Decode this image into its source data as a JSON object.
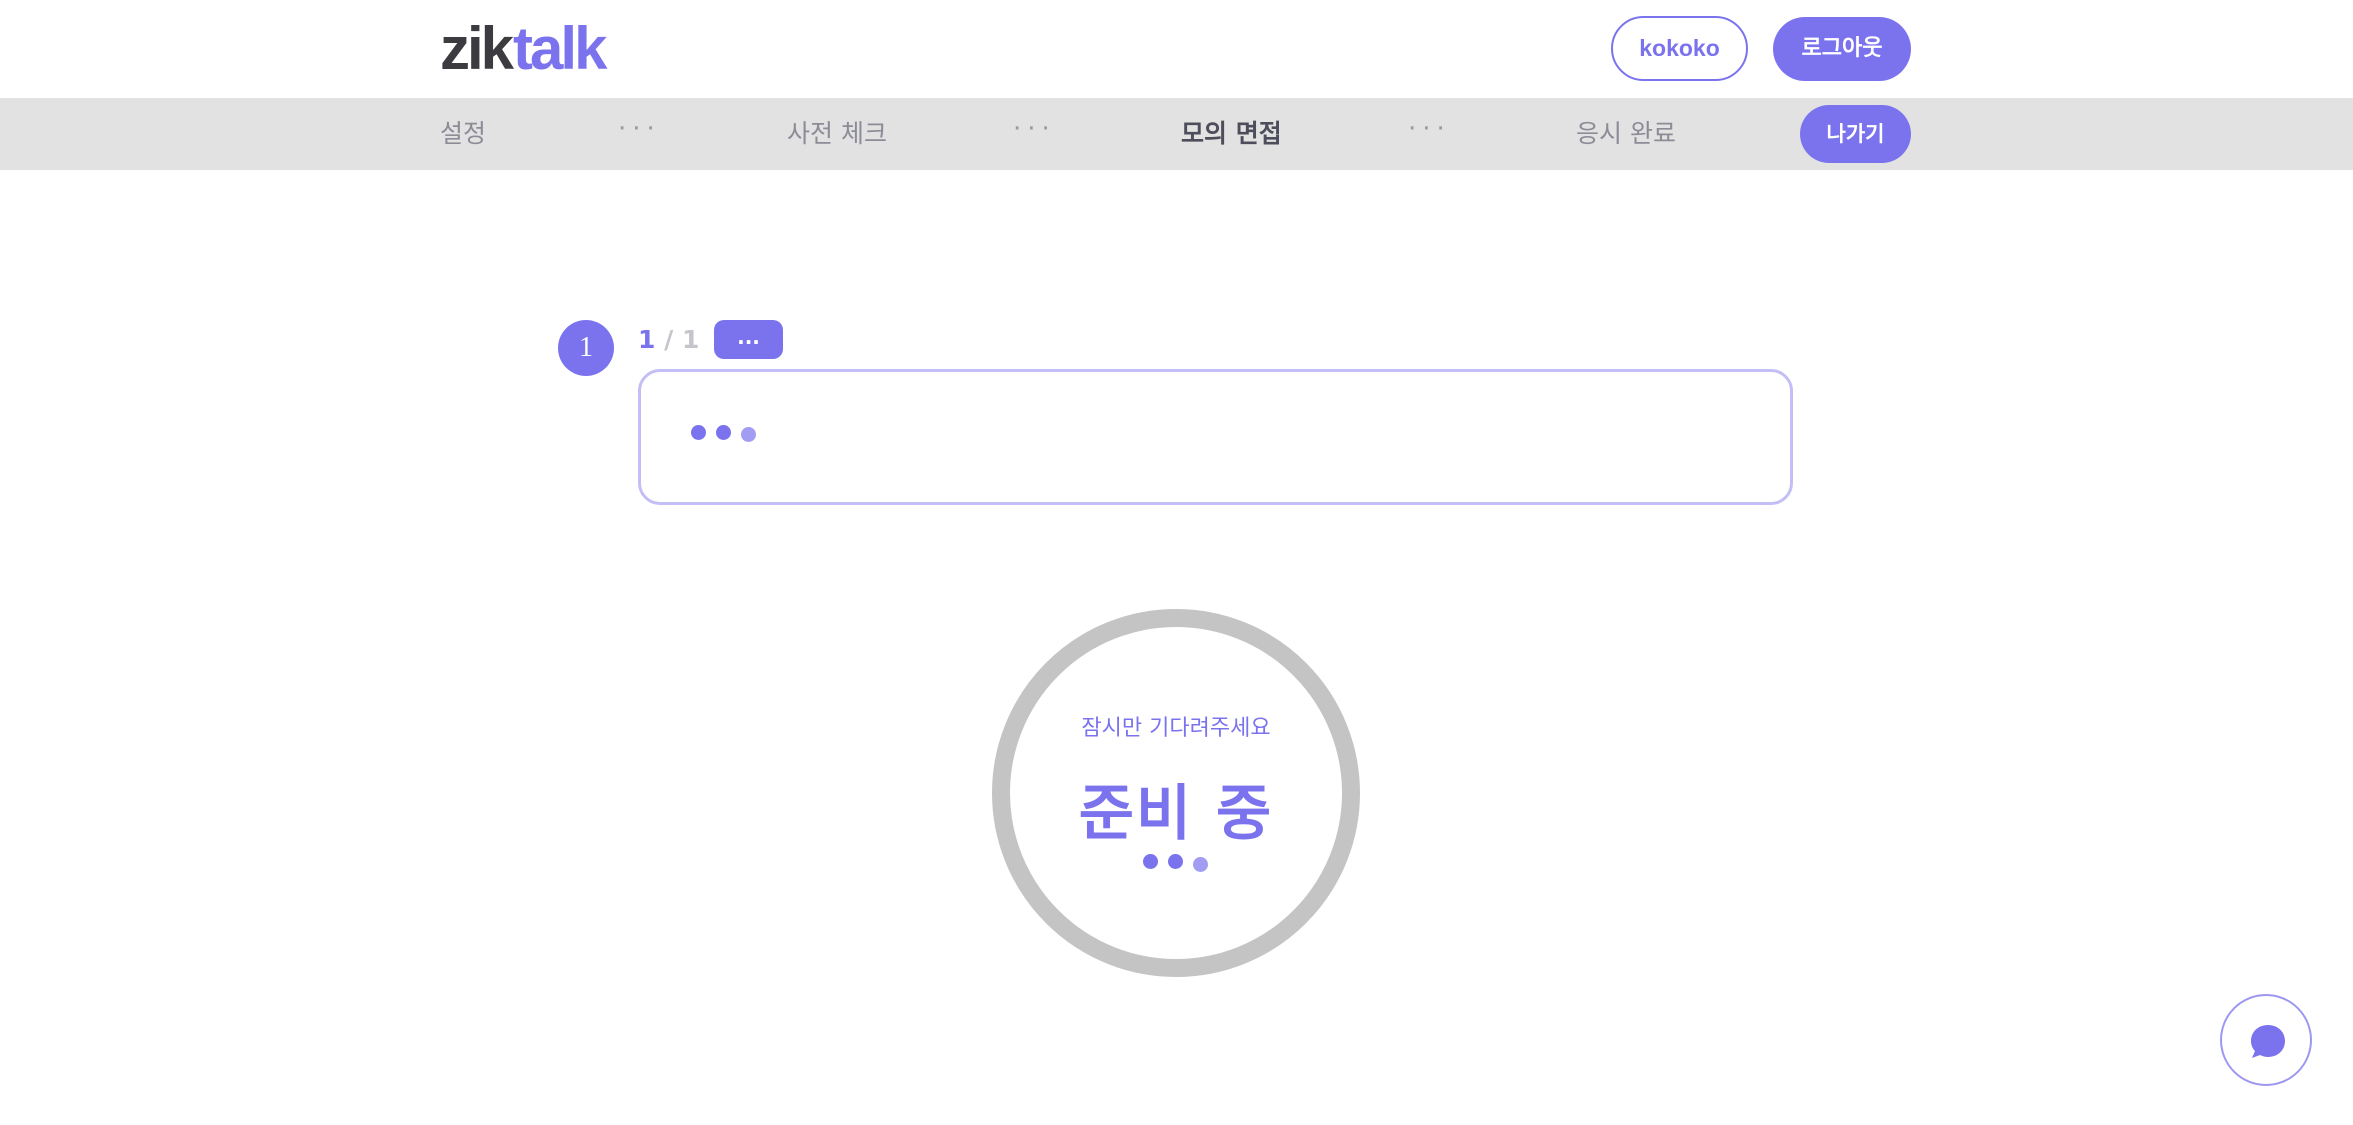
{
  "brand": {
    "logo_left": "zik",
    "logo_right": "talk",
    "accent": "#7b73ee"
  },
  "header": {
    "user_label": "kokoko",
    "logout_label": "로그아웃"
  },
  "steps": {
    "items": [
      {
        "label": "설정",
        "state": "inactive"
      },
      {
        "label": "사전 체크",
        "state": "inactive"
      },
      {
        "label": "모의 면접",
        "state": "active"
      },
      {
        "label": "응시 완료",
        "state": "inactive"
      }
    ],
    "separator": "···",
    "exit_label": "나가기"
  },
  "question": {
    "number": "1",
    "current": "1",
    "separator": "/",
    "total": "1",
    "tag_label": "..."
  },
  "status": {
    "subtitle": "잠시만 기다려주세요",
    "title": "준비 중"
  },
  "icons": {
    "chat": "chat-bubble-icon"
  }
}
